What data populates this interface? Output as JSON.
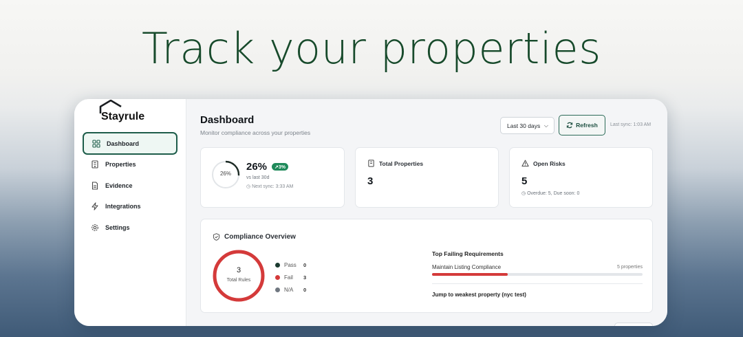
{
  "headline": "Track your properties",
  "brand": {
    "name": "Stayrule",
    "accent": "#1c5c49"
  },
  "sidebar": {
    "items": [
      {
        "label": "Dashboard",
        "icon": "grid-icon",
        "active": true
      },
      {
        "label": "Properties",
        "icon": "building-icon",
        "active": false
      },
      {
        "label": "Evidence",
        "icon": "document-icon",
        "active": false
      },
      {
        "label": "Integrations",
        "icon": "zap-icon",
        "active": false
      },
      {
        "label": "Settings",
        "icon": "gear-icon",
        "active": false
      }
    ]
  },
  "header": {
    "title": "Dashboard",
    "subtitle": "Monitor compliance across your properties",
    "range_value": "Last 30 days",
    "refresh_label": "Refresh",
    "last_sync": "Last sync: 1:03 AM"
  },
  "score_card": {
    "ring_label": "26%",
    "value": "26%",
    "fraction": 0.26,
    "delta": "↗3%",
    "vs": "vs last 30d",
    "next_sync": "Next sync: 3:33 AM"
  },
  "properties_card": {
    "label": "Total Properties",
    "value": "3"
  },
  "risks_card": {
    "label": "Open Risks",
    "value": "5",
    "note": "Overdue: 5, Due soon: 0"
  },
  "overview": {
    "title": "Compliance Overview",
    "total": "3",
    "total_label": "Total Rules",
    "legend": [
      {
        "label": "Pass",
        "value": "0",
        "color": "#1b3a2f"
      },
      {
        "label": "Fail",
        "value": "3",
        "color": "#d43a3a"
      },
      {
        "label": "N/A",
        "value": "0",
        "color": "#707780"
      }
    ],
    "top_failing_title": "Top Failing Requirements",
    "requirement": "Maintain Listing Compliance",
    "requirement_count": "5 properties",
    "requirement_fraction": 0.36,
    "jump_link": "Jump to weakest property (nyc test)"
  }
}
